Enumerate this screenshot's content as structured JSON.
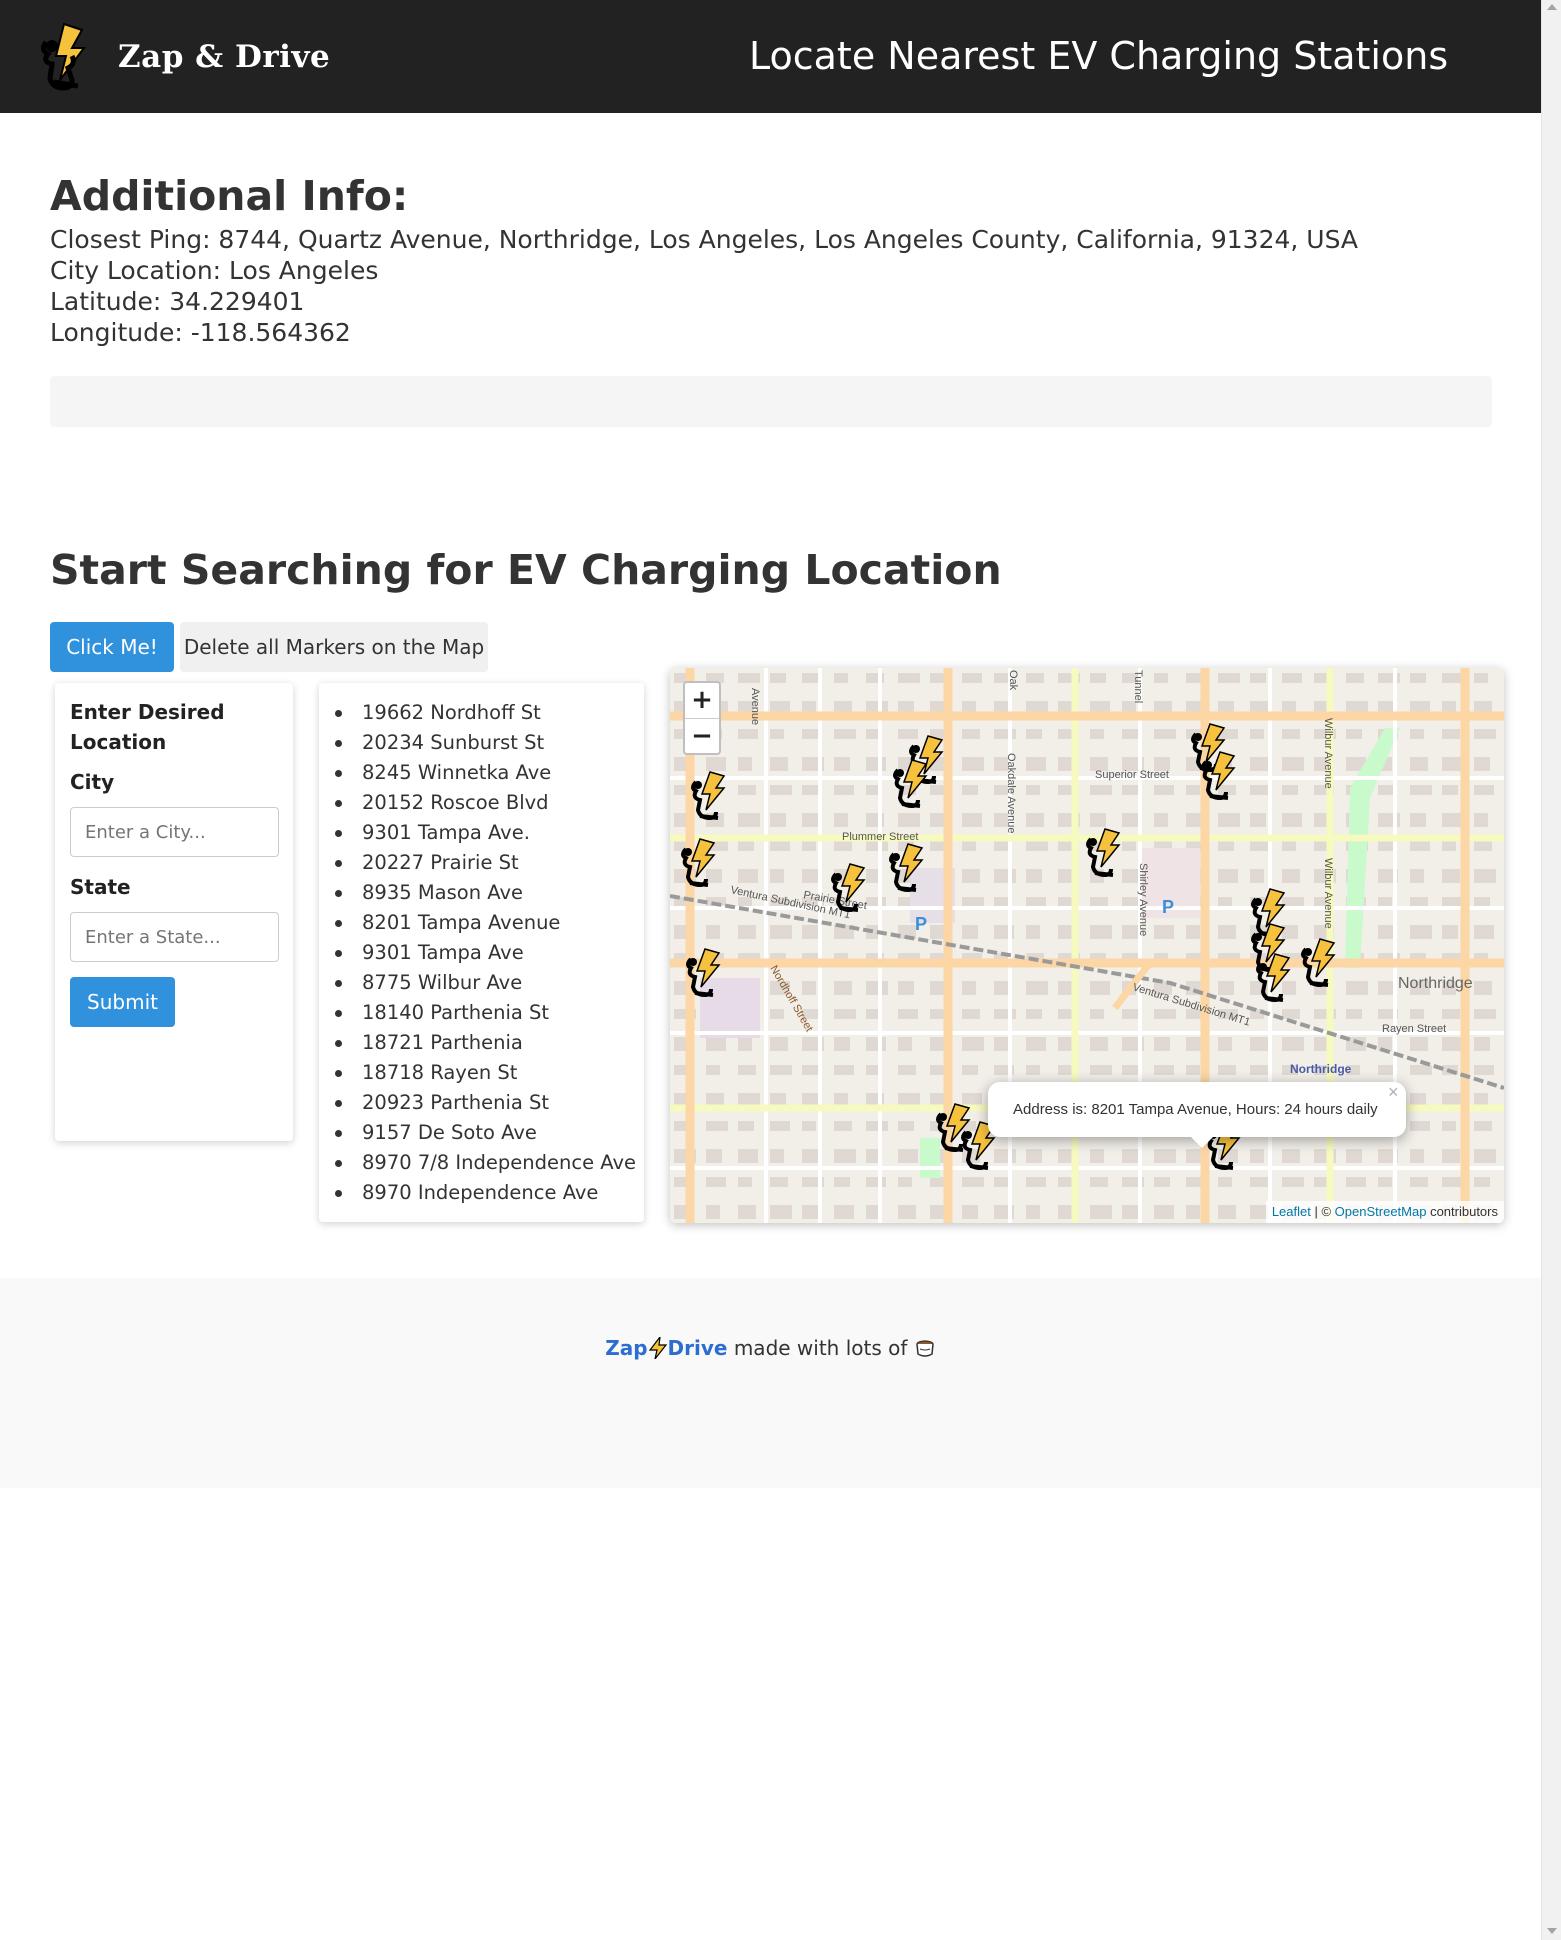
{
  "header": {
    "brand": "Zap & Drive",
    "title": "Locate Nearest EV Charging Stations"
  },
  "info": {
    "heading": "Additional Info:",
    "closest_ping": "Closest Ping: 8744, Quartz Avenue, Northridge, Los Angeles, Los Angeles County, California, 91324, USA",
    "city_location": "City Location: Los Angeles",
    "latitude": "Latitude: 34.229401",
    "longitude": "Longitude: -118.564362"
  },
  "search": {
    "heading": "Start Searching for EV Charging Location",
    "click_label": "Click Me!",
    "delete_label": "Delete all Markers on the Map"
  },
  "form": {
    "title": "Enter Desired Location",
    "city_label": "City",
    "city_placeholder": "Enter a City...",
    "state_label": "State",
    "state_placeholder": "Enter a State...",
    "submit_label": "Submit"
  },
  "locations": [
    "19662 Nordhoff St",
    "20234 Sunburst St",
    "8245 Winnetka Ave",
    "20152 Roscoe Blvd",
    "9301 Tampa Ave.",
    "20227 Prairie St",
    "8935 Mason Ave",
    "8201 Tampa Avenue",
    "9301 Tampa Ave",
    "8775 Wilbur Ave",
    "18140 Parthenia St",
    "18721 Parthenia",
    "18718 Rayen St",
    "20923 Parthenia St",
    "9157 De Soto Ave",
    "8970 7/8 Independence Ave",
    "8970 Independence Ave"
  ],
  "map": {
    "zoom_in": "+",
    "zoom_out": "−",
    "popup_text": "Address is: 8201 Tampa Avenue, Hours: 24 hours daily",
    "popup_close": "×",
    "attribution_leaflet": "Leaflet",
    "attribution_sep": " | © ",
    "attribution_osm": "OpenStreetMap",
    "attribution_tail": " contributors",
    "street_labels": {
      "avenue_left": "Avenue",
      "oak": "Oak",
      "tunnel": "Tunnel",
      "superior": "Superior Street",
      "wilbur1": "Wilbur Avenue",
      "wilbur2": "Wilbur Avenue",
      "plummer": "Plummer Street",
      "prairie": "Prairie Street",
      "oakdale": "Oakdale Avenue",
      "shirley": "Shirley Avenue",
      "ventura1": "Ventura Subdivision MT1",
      "ventura2": "Ventura Subdivision MT1",
      "nordhoff": "Nordhoff Street",
      "northridge_big": "Northridge",
      "northridge_small": "Northridge",
      "rayen": "Rayen Street",
      "parking": "P"
    },
    "colors": {
      "base": "#f2efe9",
      "major_road": "#fcd6a4",
      "minor_road": "#ffffff",
      "secondary_road": "#f7fabf",
      "rail": "#999999",
      "park": "#c8facc",
      "bolt": "#f6c23e"
    }
  },
  "footer": {
    "brand_zap": "Zap",
    "brand_drive": "Drive",
    "text": " made with lots of "
  },
  "colors": {
    "navbar": "#222222",
    "primary": "#3091dd",
    "footer_brand": "#2d6dd1"
  }
}
